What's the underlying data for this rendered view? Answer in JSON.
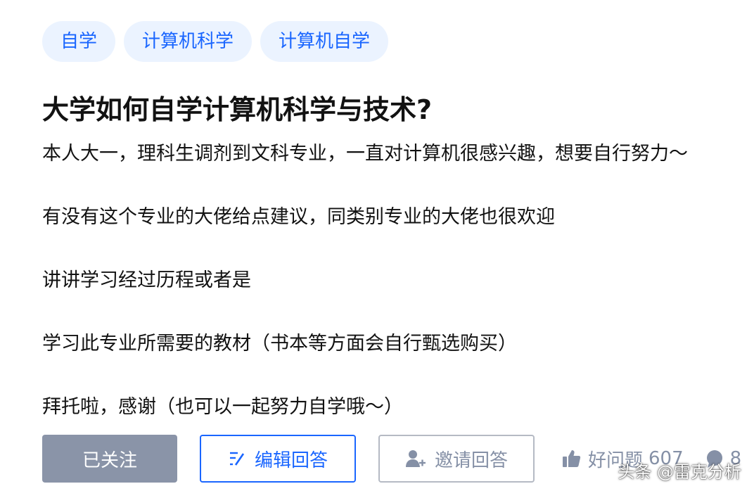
{
  "topics": [
    "自学",
    "计算机科学",
    "计算机自学"
  ],
  "question": {
    "title": "大学如何自学计算机科学与技术?",
    "detail": [
      "本人大一，理科生调剂到文科专业，一直对计算机很感兴趣，想要自行努力～",
      "有没有这个专业的大佬给点建议，同类别专业的大佬也很欢迎",
      "讲讲学习经过历程或者是",
      "学习此专业所需要的教材（书本等方面会自行甄选购买）",
      "拜托啦，感谢（也可以一起努力自学哦～）"
    ]
  },
  "actions": {
    "follow_label": "已关注",
    "edit_label": "编辑回答",
    "invite_label": "邀请回答",
    "good_question_label": "好问题",
    "good_question_count": "607",
    "comment_count": "8"
  },
  "watermark": "头条 @雷克分析",
  "colors": {
    "accent": "#1a66ff",
    "topic_bg": "#ebf3ff",
    "followed_bg": "#8a94a8",
    "muted": "#8590a6"
  },
  "icons": {
    "edit": "edit-icon",
    "invite": "add-user-icon",
    "good_question": "thumbs-up-icon",
    "comment": "comment-icon"
  }
}
